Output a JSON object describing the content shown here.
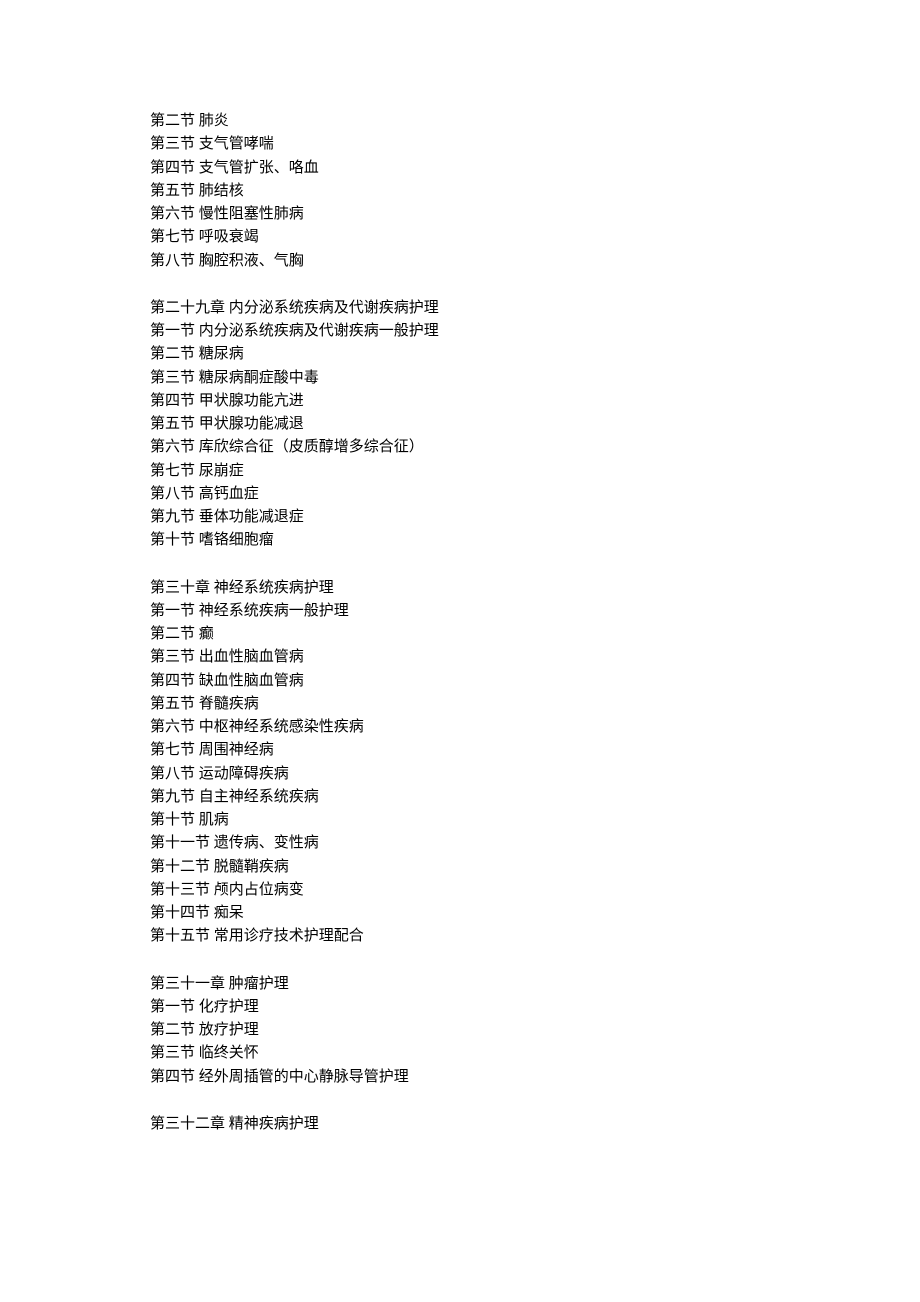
{
  "blocks": [
    {
      "heading": null,
      "sections": [
        {
          "label": "第二节",
          "title": "肺炎"
        },
        {
          "label": "第三节",
          "title": "支气管哮喘"
        },
        {
          "label": "第四节",
          "title": "支气管扩张、咯血"
        },
        {
          "label": "第五节",
          "title": "肺结核"
        },
        {
          "label": "第六节",
          "title": "慢性阻塞性肺病"
        },
        {
          "label": "第七节",
          "title": "呼吸衰竭"
        },
        {
          "label": "第八节",
          "title": "胸腔积液、气胸"
        }
      ]
    },
    {
      "heading": {
        "label": "第二十九章",
        "title": "内分泌系统疾病及代谢疾病护理"
      },
      "sections": [
        {
          "label": "第一节",
          "title": "内分泌系统疾病及代谢疾病一般护理"
        },
        {
          "label": "第二节",
          "title": "糖尿病"
        },
        {
          "label": "第三节",
          "title": "糖尿病酮症酸中毒"
        },
        {
          "label": "第四节",
          "title": "甲状腺功能亢进"
        },
        {
          "label": "第五节",
          "title": "甲状腺功能减退"
        },
        {
          "label": "第六节",
          "title": "库欣综合征（皮质醇增多综合征）"
        },
        {
          "label": "第七节",
          "title": "尿崩症"
        },
        {
          "label": "第八节",
          "title": "高钙血症"
        },
        {
          "label": "第九节",
          "title": "垂体功能减退症"
        },
        {
          "label": "第十节",
          "title": "嗜铬细胞瘤"
        }
      ]
    },
    {
      "heading": {
        "label": "第三十章",
        "title": "神经系统疾病护理"
      },
      "sections": [
        {
          "label": "第一节",
          "title": "神经系统疾病一般护理"
        },
        {
          "label": "第二节",
          "title": "癫"
        },
        {
          "label": "第三节",
          "title": "出血性脑血管病"
        },
        {
          "label": "第四节",
          "title": "缺血性脑血管病"
        },
        {
          "label": "第五节",
          "title": "脊髓疾病"
        },
        {
          "label": "第六节",
          "title": "中枢神经系统感染性疾病"
        },
        {
          "label": "第七节",
          "title": "周围神经病"
        },
        {
          "label": "第八节",
          "title": "运动障碍疾病"
        },
        {
          "label": "第九节",
          "title": "自主神经系统疾病"
        },
        {
          "label": "第十节",
          "title": "肌病"
        },
        {
          "label": "第十一节",
          "title": "遗传病、变性病"
        },
        {
          "label": "第十二节",
          "title": "脱髓鞘疾病"
        },
        {
          "label": "第十三节",
          "title": "颅内占位病变"
        },
        {
          "label": "第十四节",
          "title": "痴呆"
        },
        {
          "label": "第十五节",
          "title": "常用诊疗技术护理配合"
        }
      ]
    },
    {
      "heading": {
        "label": "第三十一章",
        "title": "肿瘤护理"
      },
      "sections": [
        {
          "label": "第一节",
          "title": "化疗护理"
        },
        {
          "label": "第二节",
          "title": "放疗护理"
        },
        {
          "label": "第三节",
          "title": "临终关怀"
        },
        {
          "label": "第四节",
          "title": "经外周插管的中心静脉导管护理"
        }
      ]
    },
    {
      "heading": {
        "label": "第三十二章",
        "title": "精神疾病护理"
      },
      "sections": []
    }
  ]
}
